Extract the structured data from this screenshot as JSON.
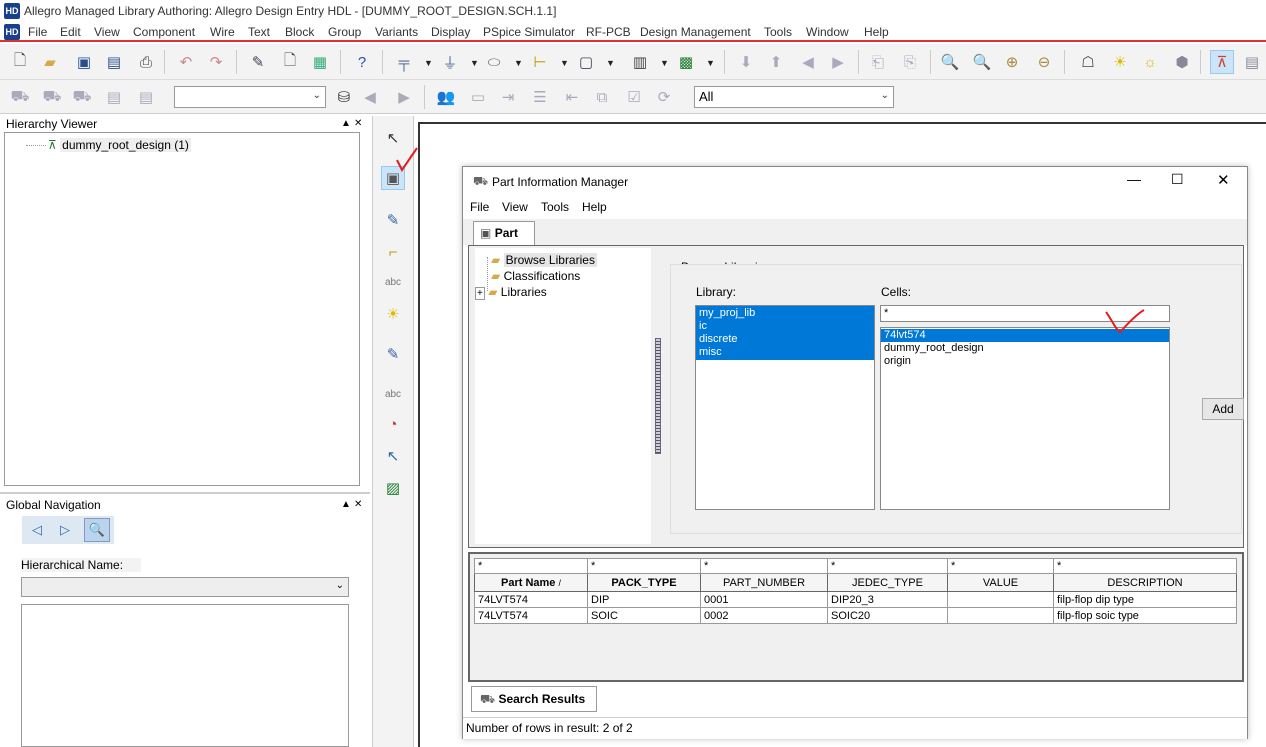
{
  "window": {
    "title": "Allegro Managed Library Authoring: Allegro Design Entry HDL - [DUMMY_ROOT_DESIGN.SCH.1.1]"
  },
  "menubar": [
    "File",
    "Edit",
    "View",
    "Component",
    "Wire",
    "Text",
    "Block",
    "Group",
    "Variants",
    "Display",
    "PSpice Simulator",
    "RF-PCB",
    "Design Management",
    "Tools",
    "Window",
    "Help"
  ],
  "toolbar2": {
    "search_combo_value": "",
    "filter_combo_value": "All"
  },
  "hierarchy_viewer": {
    "title": "Hierarchy Viewer",
    "root_item": "dummy_root_design (1)"
  },
  "global_navigation": {
    "title": "Global Navigation",
    "hierarchical_name_label": "Hierarchical Name:",
    "hierarchical_name_value": ""
  },
  "panel_controls": {
    "pin": "▲",
    "close": "✕"
  },
  "pim": {
    "title": "Part Information Manager",
    "menu": [
      "File",
      "View",
      "Tools",
      "Help"
    ],
    "part_tab": "Part",
    "tree": [
      "Browse Libraries",
      "Classifications",
      "Libraries"
    ],
    "browse_group_title": "Browse Libraries",
    "library_label": "Library:",
    "libraries": [
      "my_proj_lib",
      "ic",
      "discrete",
      "misc"
    ],
    "cells_label": "Cells:",
    "cells_filter": "*",
    "cells": [
      "74lvt574",
      "dummy_root_design",
      "origin"
    ],
    "add_button": "Add",
    "filters": [
      "*",
      "*",
      "*",
      "*",
      "*",
      "*"
    ],
    "columns": [
      "Part Name",
      "PACK_TYPE",
      "PART_NUMBER",
      "JEDEC_TYPE",
      "VALUE",
      "DESCRIPTION"
    ],
    "sort_indicator": "/",
    "rows": [
      [
        "74LVT574",
        "DIP",
        "0001",
        "DIP20_3",
        "",
        "filp-flop dip type"
      ],
      [
        "74LVT574",
        "SOIC",
        "0002",
        "SOIC20",
        "",
        "filp-flop soic type"
      ]
    ],
    "search_results_tab": "Search Results",
    "status": "Number of rows in result: 2 of 2"
  },
  "colors": {
    "accent_red": "#e03030",
    "selection_blue": "#0078d7",
    "annotation_red": "#e02020"
  }
}
